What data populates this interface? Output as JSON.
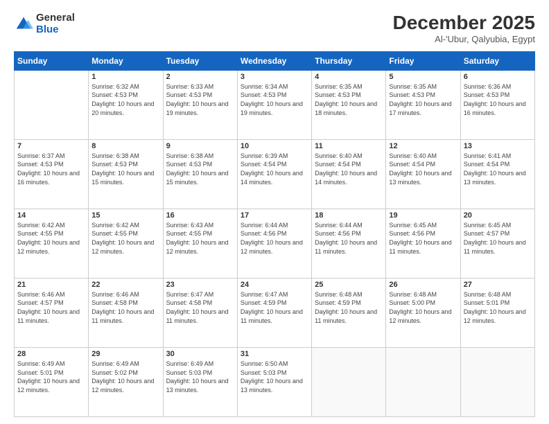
{
  "logo": {
    "general": "General",
    "blue": "Blue"
  },
  "header": {
    "title": "December 2025",
    "subtitle": "Al-'Ubur, Qalyubia, Egypt"
  },
  "weekdays": [
    "Sunday",
    "Monday",
    "Tuesday",
    "Wednesday",
    "Thursday",
    "Friday",
    "Saturday"
  ],
  "weeks": [
    [
      {
        "day": null,
        "info": null
      },
      {
        "day": "1",
        "sunrise": "6:32 AM",
        "sunset": "4:53 PM",
        "daylight": "10 hours and 20 minutes."
      },
      {
        "day": "2",
        "sunrise": "6:33 AM",
        "sunset": "4:53 PM",
        "daylight": "10 hours and 19 minutes."
      },
      {
        "day": "3",
        "sunrise": "6:34 AM",
        "sunset": "4:53 PM",
        "daylight": "10 hours and 19 minutes."
      },
      {
        "day": "4",
        "sunrise": "6:35 AM",
        "sunset": "4:53 PM",
        "daylight": "10 hours and 18 minutes."
      },
      {
        "day": "5",
        "sunrise": "6:35 AM",
        "sunset": "4:53 PM",
        "daylight": "10 hours and 17 minutes."
      },
      {
        "day": "6",
        "sunrise": "6:36 AM",
        "sunset": "4:53 PM",
        "daylight": "10 hours and 16 minutes."
      }
    ],
    [
      {
        "day": "7",
        "sunrise": "6:37 AM",
        "sunset": "4:53 PM",
        "daylight": "10 hours and 16 minutes."
      },
      {
        "day": "8",
        "sunrise": "6:38 AM",
        "sunset": "4:53 PM",
        "daylight": "10 hours and 15 minutes."
      },
      {
        "day": "9",
        "sunrise": "6:38 AM",
        "sunset": "4:53 PM",
        "daylight": "10 hours and 15 minutes."
      },
      {
        "day": "10",
        "sunrise": "6:39 AM",
        "sunset": "4:54 PM",
        "daylight": "10 hours and 14 minutes."
      },
      {
        "day": "11",
        "sunrise": "6:40 AM",
        "sunset": "4:54 PM",
        "daylight": "10 hours and 14 minutes."
      },
      {
        "day": "12",
        "sunrise": "6:40 AM",
        "sunset": "4:54 PM",
        "daylight": "10 hours and 13 minutes."
      },
      {
        "day": "13",
        "sunrise": "6:41 AM",
        "sunset": "4:54 PM",
        "daylight": "10 hours and 13 minutes."
      }
    ],
    [
      {
        "day": "14",
        "sunrise": "6:42 AM",
        "sunset": "4:55 PM",
        "daylight": "10 hours and 12 minutes."
      },
      {
        "day": "15",
        "sunrise": "6:42 AM",
        "sunset": "4:55 PM",
        "daylight": "10 hours and 12 minutes."
      },
      {
        "day": "16",
        "sunrise": "6:43 AM",
        "sunset": "4:55 PM",
        "daylight": "10 hours and 12 minutes."
      },
      {
        "day": "17",
        "sunrise": "6:44 AM",
        "sunset": "4:56 PM",
        "daylight": "10 hours and 12 minutes."
      },
      {
        "day": "18",
        "sunrise": "6:44 AM",
        "sunset": "4:56 PM",
        "daylight": "10 hours and 11 minutes."
      },
      {
        "day": "19",
        "sunrise": "6:45 AM",
        "sunset": "4:56 PM",
        "daylight": "10 hours and 11 minutes."
      },
      {
        "day": "20",
        "sunrise": "6:45 AM",
        "sunset": "4:57 PM",
        "daylight": "10 hours and 11 minutes."
      }
    ],
    [
      {
        "day": "21",
        "sunrise": "6:46 AM",
        "sunset": "4:57 PM",
        "daylight": "10 hours and 11 minutes."
      },
      {
        "day": "22",
        "sunrise": "6:46 AM",
        "sunset": "4:58 PM",
        "daylight": "10 hours and 11 minutes."
      },
      {
        "day": "23",
        "sunrise": "6:47 AM",
        "sunset": "4:58 PM",
        "daylight": "10 hours and 11 minutes."
      },
      {
        "day": "24",
        "sunrise": "6:47 AM",
        "sunset": "4:59 PM",
        "daylight": "10 hours and 11 minutes."
      },
      {
        "day": "25",
        "sunrise": "6:48 AM",
        "sunset": "4:59 PM",
        "daylight": "10 hours and 11 minutes."
      },
      {
        "day": "26",
        "sunrise": "6:48 AM",
        "sunset": "5:00 PM",
        "daylight": "10 hours and 12 minutes."
      },
      {
        "day": "27",
        "sunrise": "6:48 AM",
        "sunset": "5:01 PM",
        "daylight": "10 hours and 12 minutes."
      }
    ],
    [
      {
        "day": "28",
        "sunrise": "6:49 AM",
        "sunset": "5:01 PM",
        "daylight": "10 hours and 12 minutes."
      },
      {
        "day": "29",
        "sunrise": "6:49 AM",
        "sunset": "5:02 PM",
        "daylight": "10 hours and 12 minutes."
      },
      {
        "day": "30",
        "sunrise": "6:49 AM",
        "sunset": "5:03 PM",
        "daylight": "10 hours and 13 minutes."
      },
      {
        "day": "31",
        "sunrise": "6:50 AM",
        "sunset": "5:03 PM",
        "daylight": "10 hours and 13 minutes."
      },
      null,
      null,
      null
    ]
  ]
}
